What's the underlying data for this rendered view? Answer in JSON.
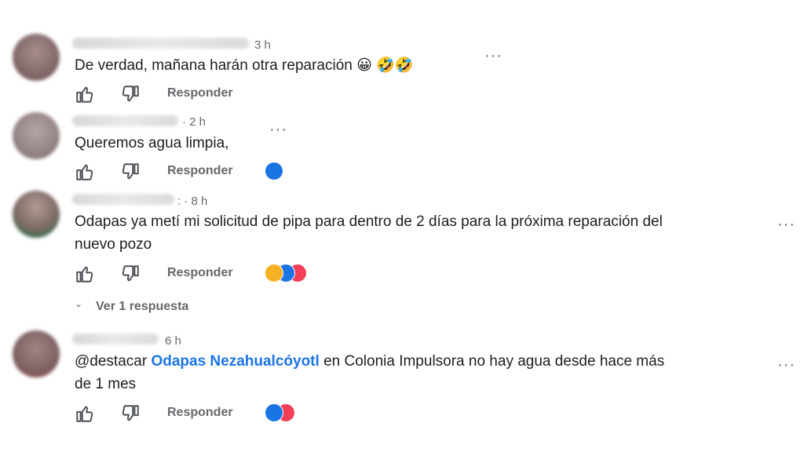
{
  "colors": {
    "like_blue": "#1b74e4",
    "love_red": "#f33e58",
    "haha_yellow": "#f7b125",
    "meta_grey": "#65676b"
  },
  "icons": {
    "like": "thumbs-up-icon",
    "dislike": "thumbs-down-icon",
    "more": "more-options-icon"
  },
  "comments": [
    {
      "time": "3 h",
      "text": "De verdad, mañana harán otra reparación 😀 🤣🤣",
      "reply_label": "Responder",
      "reactions": []
    },
    {
      "time": "· 2 h",
      "text": "Queremos agua limpia,",
      "reply_label": "Responder",
      "reactions": [
        "like"
      ]
    },
    {
      "time": ": · 8 h",
      "text_line1": "Odapas ya metí mi solicitud de pipa para dentro de 2 días para la próxima reparación del",
      "text_line2": "nuevo pozo",
      "reply_label": "Responder",
      "reactions": [
        "haha",
        "like",
        "love"
      ],
      "view_replies": "Ver 1 respuesta"
    },
    {
      "time": "6 h",
      "text_prefix": "@destacar ",
      "mention": "Odapas Nezahualcóyotl",
      "text_suffix": " en Colonia Impulsora no hay agua desde hace más",
      "text_line2": "de 1 mes",
      "reply_label": "Responder",
      "reactions": [
        "like",
        "love"
      ]
    }
  ]
}
